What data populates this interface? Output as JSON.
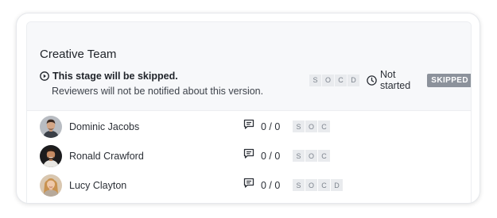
{
  "stage": {
    "title": "Creative Team",
    "skip_message": "This stage will be skipped.",
    "note": "Reviewers will not be notified about this version.",
    "decisions": [
      "S",
      "O",
      "C",
      "D"
    ],
    "status": "Not started",
    "badge": "SKIPPED"
  },
  "reviewers": [
    {
      "name": "Dominic Jacobs",
      "comments": "0 / 0",
      "decisions": [
        "S",
        "O",
        "C"
      ]
    },
    {
      "name": "Ronald Crawford",
      "comments": "0 / 0",
      "decisions": [
        "S",
        "O",
        "C"
      ]
    },
    {
      "name": "Lucy Clayton",
      "comments": "0 / 0",
      "decisions": [
        "S",
        "O",
        "C",
        "D"
      ]
    }
  ],
  "icons": {
    "skip": "play-circle-icon",
    "status": "clock-icon",
    "comment": "comment-icon"
  },
  "colors": {
    "badge_bg": "#8c929b",
    "chip_bg": "#e9ebee",
    "header_bg": "#f7f8fa"
  }
}
